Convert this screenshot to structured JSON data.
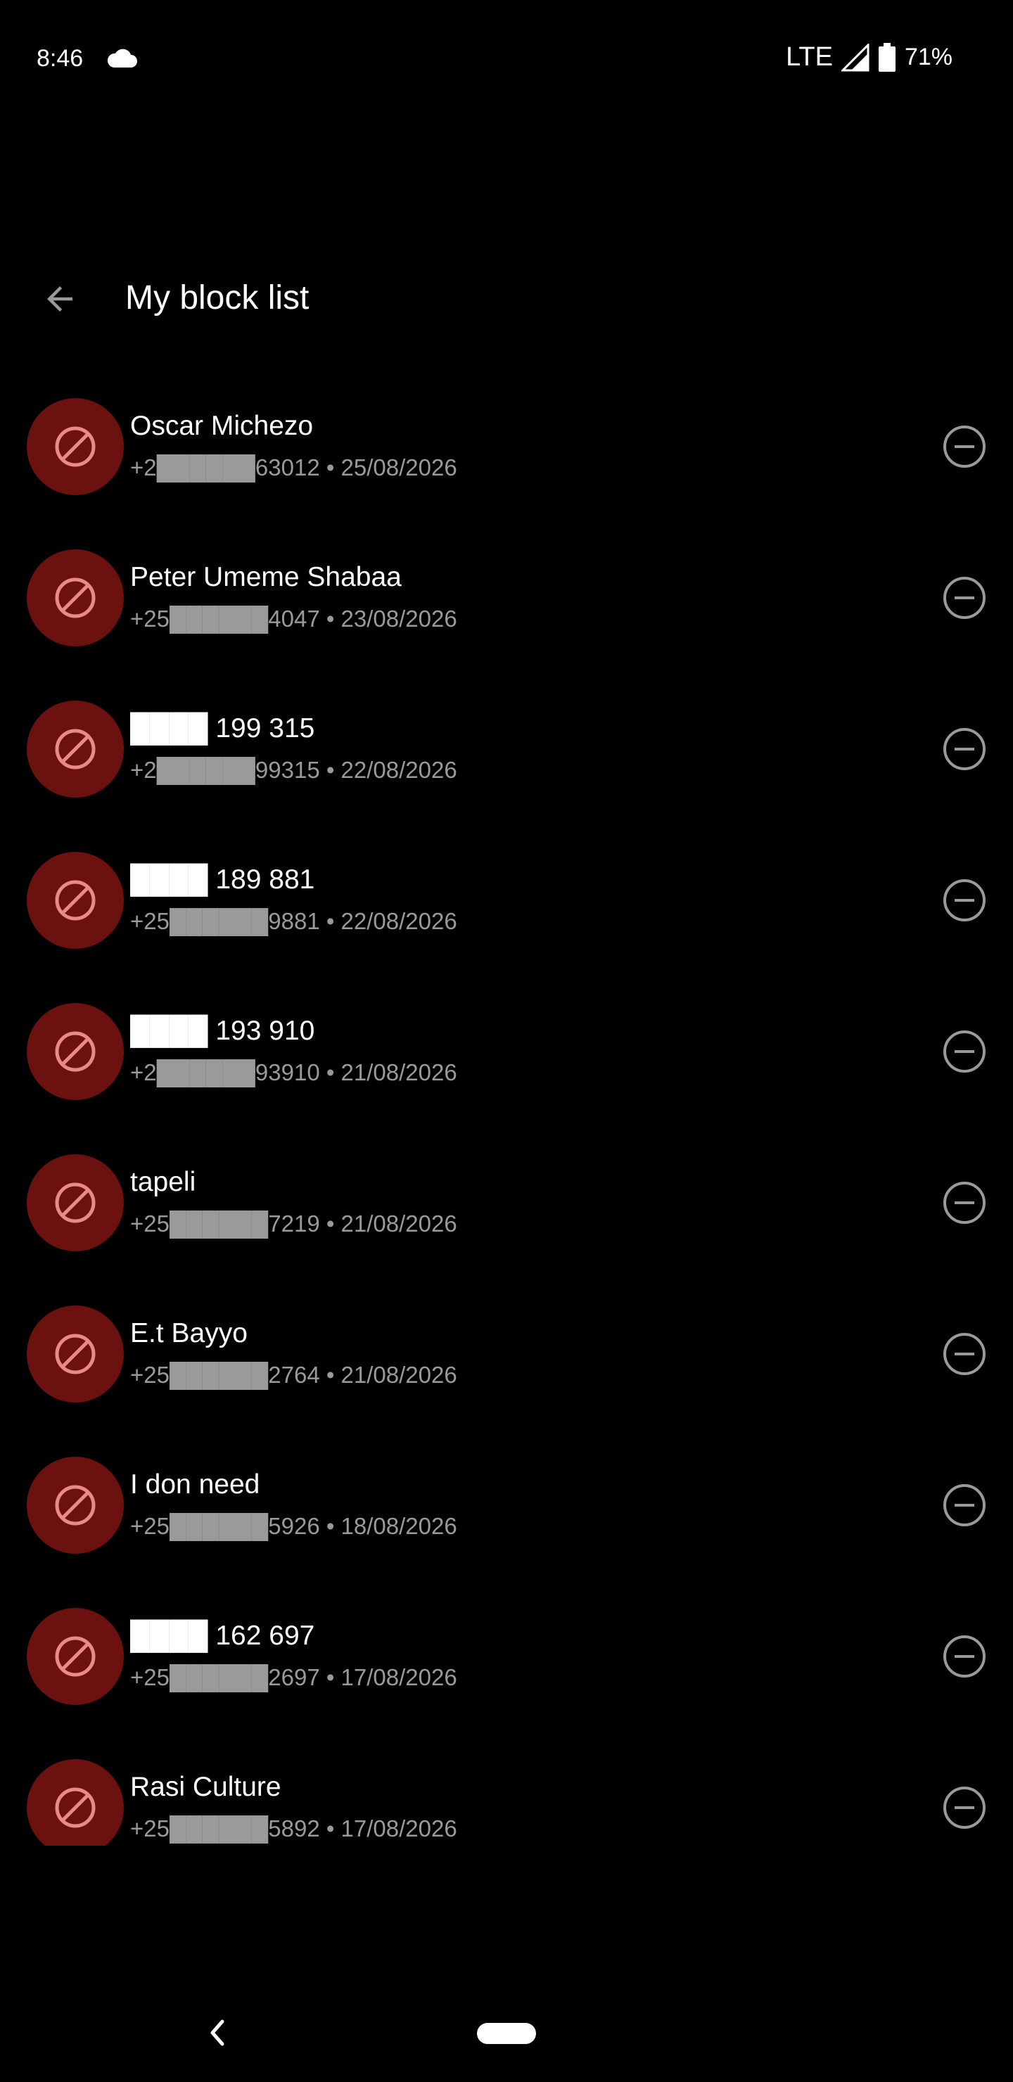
{
  "status_bar": {
    "time": "8:46",
    "network": "LTE",
    "battery": "71%"
  },
  "header": {
    "title": "My block list"
  },
  "colors": {
    "avatar_bg": "#6b1210",
    "block_icon": "#e98a86",
    "secondary_text": "#9a9a9a"
  },
  "blocked": [
    {
      "name": "Oscar Michezo",
      "subtitle": "+2██████63012 • 25/08/2026"
    },
    {
      "name": "Peter Umeme Shabaa",
      "subtitle": "+25██████4047 • 23/08/2026"
    },
    {
      "name": "████ 199 315",
      "subtitle": "+2██████99315 • 22/08/2026"
    },
    {
      "name": "████ 189 881",
      "subtitle": "+25██████9881 • 22/08/2026"
    },
    {
      "name": "████ 193 910",
      "subtitle": "+2██████93910 • 21/08/2026"
    },
    {
      "name": "tapeli",
      "subtitle": "+25██████7219 • 21/08/2026"
    },
    {
      "name": "E.t Bayyo",
      "subtitle": "+25██████2764 • 21/08/2026"
    },
    {
      "name": "I don need",
      "subtitle": "+25██████5926 • 18/08/2026"
    },
    {
      "name": "████ 162 697",
      "subtitle": "+25██████2697 • 17/08/2026"
    },
    {
      "name": "Rasi Culture",
      "subtitle": "+25██████5892 • 17/08/2026"
    }
  ]
}
